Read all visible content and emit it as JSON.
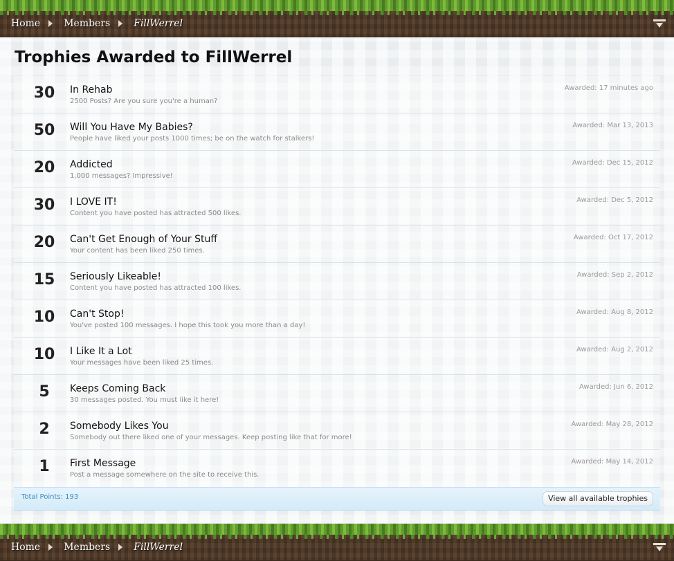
{
  "breadcrumb": {
    "items": [
      "Home",
      "Members"
    ],
    "current": "FillWerrel"
  },
  "page_title": "Trophies Awarded to FillWerrel",
  "trophies": [
    {
      "points": "30",
      "title": "In Rehab",
      "desc": "2500 Posts? Are you sure you're a human?",
      "date": "Awarded: 17 minutes ago"
    },
    {
      "points": "50",
      "title": "Will You Have My Babies?",
      "desc": "People have liked your posts 1000 times; be on the watch for stalkers!",
      "date": "Awarded: Mar 13, 2013"
    },
    {
      "points": "20",
      "title": "Addicted",
      "desc": "1,000 messages? Impressive!",
      "date": "Awarded: Dec 15, 2012"
    },
    {
      "points": "30",
      "title": "I LOVE IT!",
      "desc": "Content you have posted has attracted 500 likes.",
      "date": "Awarded: Dec 5, 2012"
    },
    {
      "points": "20",
      "title": "Can't Get Enough of Your Stuff",
      "desc": "Your content has been liked 250 times.",
      "date": "Awarded: Oct 17, 2012"
    },
    {
      "points": "15",
      "title": "Seriously Likeable!",
      "desc": "Content you have posted has attracted 100 likes.",
      "date": "Awarded: Sep 2, 2012"
    },
    {
      "points": "10",
      "title": "Can't Stop!",
      "desc": "You've posted 100 messages. I hope this took you more than a day!",
      "date": "Awarded: Aug 8, 2012"
    },
    {
      "points": "10",
      "title": "I Like It a Lot",
      "desc": "Your messages have been liked 25 times.",
      "date": "Awarded: Aug 2, 2012"
    },
    {
      "points": "5",
      "title": "Keeps Coming Back",
      "desc": "30 messages posted. You must like it here!",
      "date": "Awarded: Jun 6, 2012"
    },
    {
      "points": "2",
      "title": "Somebody Likes You",
      "desc": "Somebody out there liked one of your messages. Keep posting like that for more!",
      "date": "Awarded: May 28, 2012"
    },
    {
      "points": "1",
      "title": "First Message",
      "desc": "Post a message somewhere on the site to receive this.",
      "date": "Awarded: May 14, 2012"
    }
  ],
  "footer": {
    "total_points": "Total Points: 193",
    "view_all_label": "View all available trophies"
  },
  "icons": {
    "jump": "jump-to-page-icon",
    "crumb_separator": "chevron-right-icon"
  },
  "colors": {
    "dirt": "#5c4330",
    "grass": "#5f9a2e",
    "link_blue": "#3a8bbf"
  }
}
